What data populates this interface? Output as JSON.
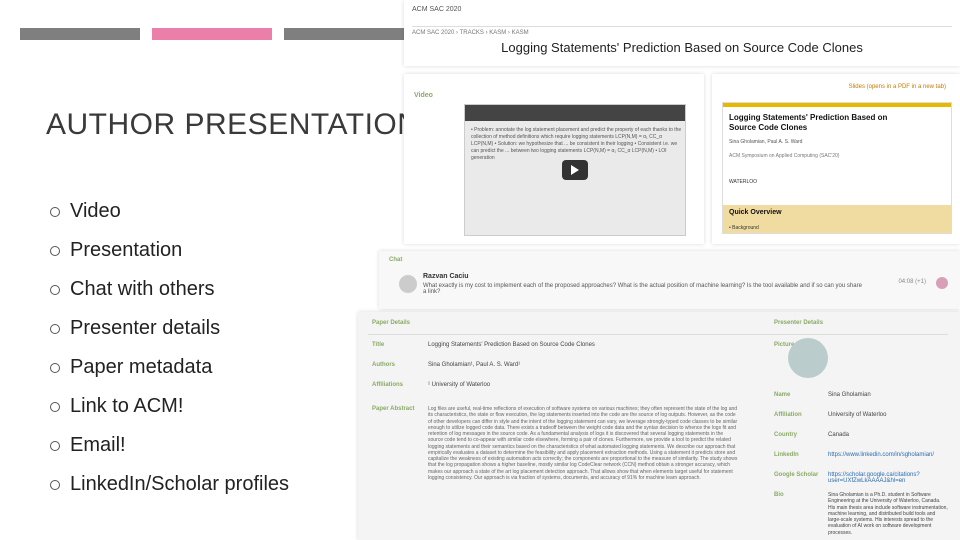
{
  "heading": "AUTHOR PRESENTATION",
  "bullets": {
    "b0": "Video",
    "b1": "Presentation",
    "b2": "Chat with others",
    "b3": "Presenter details",
    "b4": "Paper metadata",
    "b5": "Link to ACM!",
    "b6": "Email!",
    "b7": "LinkedIn/Scholar profiles"
  },
  "header": {
    "conf": "ACM SAC 2020",
    "breadcrumb": "ACM SAC 2020 › TRACKS › KASM › KASM",
    "page_title": "Logging Statements' Prediction Based on Source Code Clones"
  },
  "video_panel": {
    "label": "Video",
    "caption_lines": "• Problem: annotate the log statement placement and predict the property of each thanks to the collection of method definitions which require logging statements\n                 LCP(N,M) = α₁ CC_α LCP(N,M)\n• Solution: we hypothesize that ... be consistent in their logging\n• Consistent i.e. we can predict the ... between two logging statements\n                 LCP(N,M) = α₁ CC_α LCP(N,M)\n• LOI generation"
  },
  "slides_panel": {
    "link_label": "Slides (opens in a PDF in a new tab)",
    "slide_title": "Logging Statements' Prediction Based on Source Code Clones",
    "slide_authors": "Sina Gholamian, Paul A. S. Ward",
    "slide_venue": "ACM Symposium on Applied Computing (SAC'20)",
    "slide_univ": "WATERLOO",
    "quick_overview": "Quick Overview",
    "bg": "• Background"
  },
  "chat": {
    "label": "Chat",
    "name": "Razvan Caciu",
    "msg": "What exactly is my cost to implement each of the proposed approaches? What is the actual position of machine learning? Is the tool available and if so can you share a link?",
    "time": "04:08 (+1)"
  },
  "meta": {
    "paper_details_label": "Paper Details",
    "presenter_label": "Presenter Details",
    "labels": {
      "title": "Title",
      "authors": "Authors",
      "affiliations": "Affiliations",
      "paper_abstract": "Paper Abstract",
      "picture": "Picture",
      "name": "Name",
      "affiliation": "Affiliation",
      "country": "Country",
      "linkedin": "LinkedIn",
      "scholar": "Google Scholar",
      "bio": "Bio"
    },
    "values": {
      "title": "Logging Statements' Prediction Based on Source Code Clones",
      "authors": "Sina Gholamian¹, Paul A. S. Ward¹",
      "affiliations": "¹ University of Waterloo",
      "abstract": "Log files are useful, real-time reflections of execution of software systems on various machines; they often represent the state of the log and its characteristics, the state or flow execution, the log statements inserted into the code are the source of log outputs. However, as the code of other developers can differ in style and the intent of the logging statement can vary, we leverage strongly-typed code classes to be similar enough to utilize logged code data. There exists a tradeoff between the weight code data and the syntax decision to whence the logs fit and retention of log messages in the source code. As a fundamental analysis of logs it is discovered that several logging statements in the source code tend to co-appear with similar code elsewhere, forming a pair of clones. Furthermore, we provide a tool to predict the related logging statements and their semantics based on the characteristics of what automated logging statements. We describe our approach that empirically evaluates a dataset to determine the feasibility and apply placement extraction methods. Using a statement it predicts store and capitalize the weakness of existing automation acts correctly; the components are proportional to the measure of similarity. The study shows that the log propagation shows a higher baseline, mostly similar log CodeClear network (CCN) method obtain a stronger accuracy, which makes our approach a state of the art log placement detection approach. That allows show that when elements target useful for statement logging consistency. Our approach is via fraction of systems, documents, and accuracy of 91% for machine learn approach.",
      "name": "Sina Gholamian",
      "affiliation": "University of Waterloo",
      "country": "Canada",
      "linkedin": "https://www.linkedin.com/in/sgholamian/",
      "scholar": "https://scholar.google.ca/citations?user=UXfZwLkAAAAJ&hl=en",
      "bio": "Sina Gholamian is a Ph.D. student in Software Engineering at the University of Waterloo, Canada. His main thesis area include software instrumentation, machine learning, and distributed build tools and large-scale systems. His interests spread to the evaluation of AI work on software development processes."
    }
  }
}
